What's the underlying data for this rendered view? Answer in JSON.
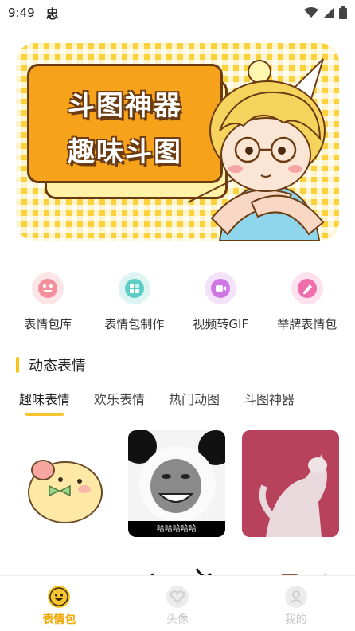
{
  "status_bar": {
    "time": "9:49",
    "app_glyph": "忠"
  },
  "banner": {
    "line1": "斗图神器",
    "line2": "趣味斗图"
  },
  "quick_actions": [
    {
      "label": "表情包库",
      "icon": "smiley-icon",
      "color": "#f6a4ad",
      "bg": "#fde4e6"
    },
    {
      "label": "表情包制作",
      "icon": "image-edit-icon",
      "color": "#67d3cd",
      "bg": "#dcf5f3"
    },
    {
      "label": "视频转GIF",
      "icon": "video-icon",
      "color": "#d37be8",
      "bg": "#f4e1fa"
    },
    {
      "label": "举牌表情包",
      "icon": "sign-icon",
      "color": "#f07ab2",
      "bg": "#fde1ee"
    }
  ],
  "section": {
    "title": "动态表情"
  },
  "tabs": [
    {
      "label": "趣味表情",
      "active": true
    },
    {
      "label": "欢乐表情",
      "active": false
    },
    {
      "label": "热门动图",
      "active": false
    },
    {
      "label": "斗图神器",
      "active": false
    }
  ],
  "grid": {
    "c2_caption": "哈哈哈哈哈"
  },
  "bottom_nav": [
    {
      "label": "表情包",
      "active": true
    },
    {
      "label": "头像",
      "active": false
    },
    {
      "label": "我的",
      "active": false
    }
  ],
  "colors": {
    "accent": "#f5c316",
    "active_nav": "#f0a800"
  }
}
